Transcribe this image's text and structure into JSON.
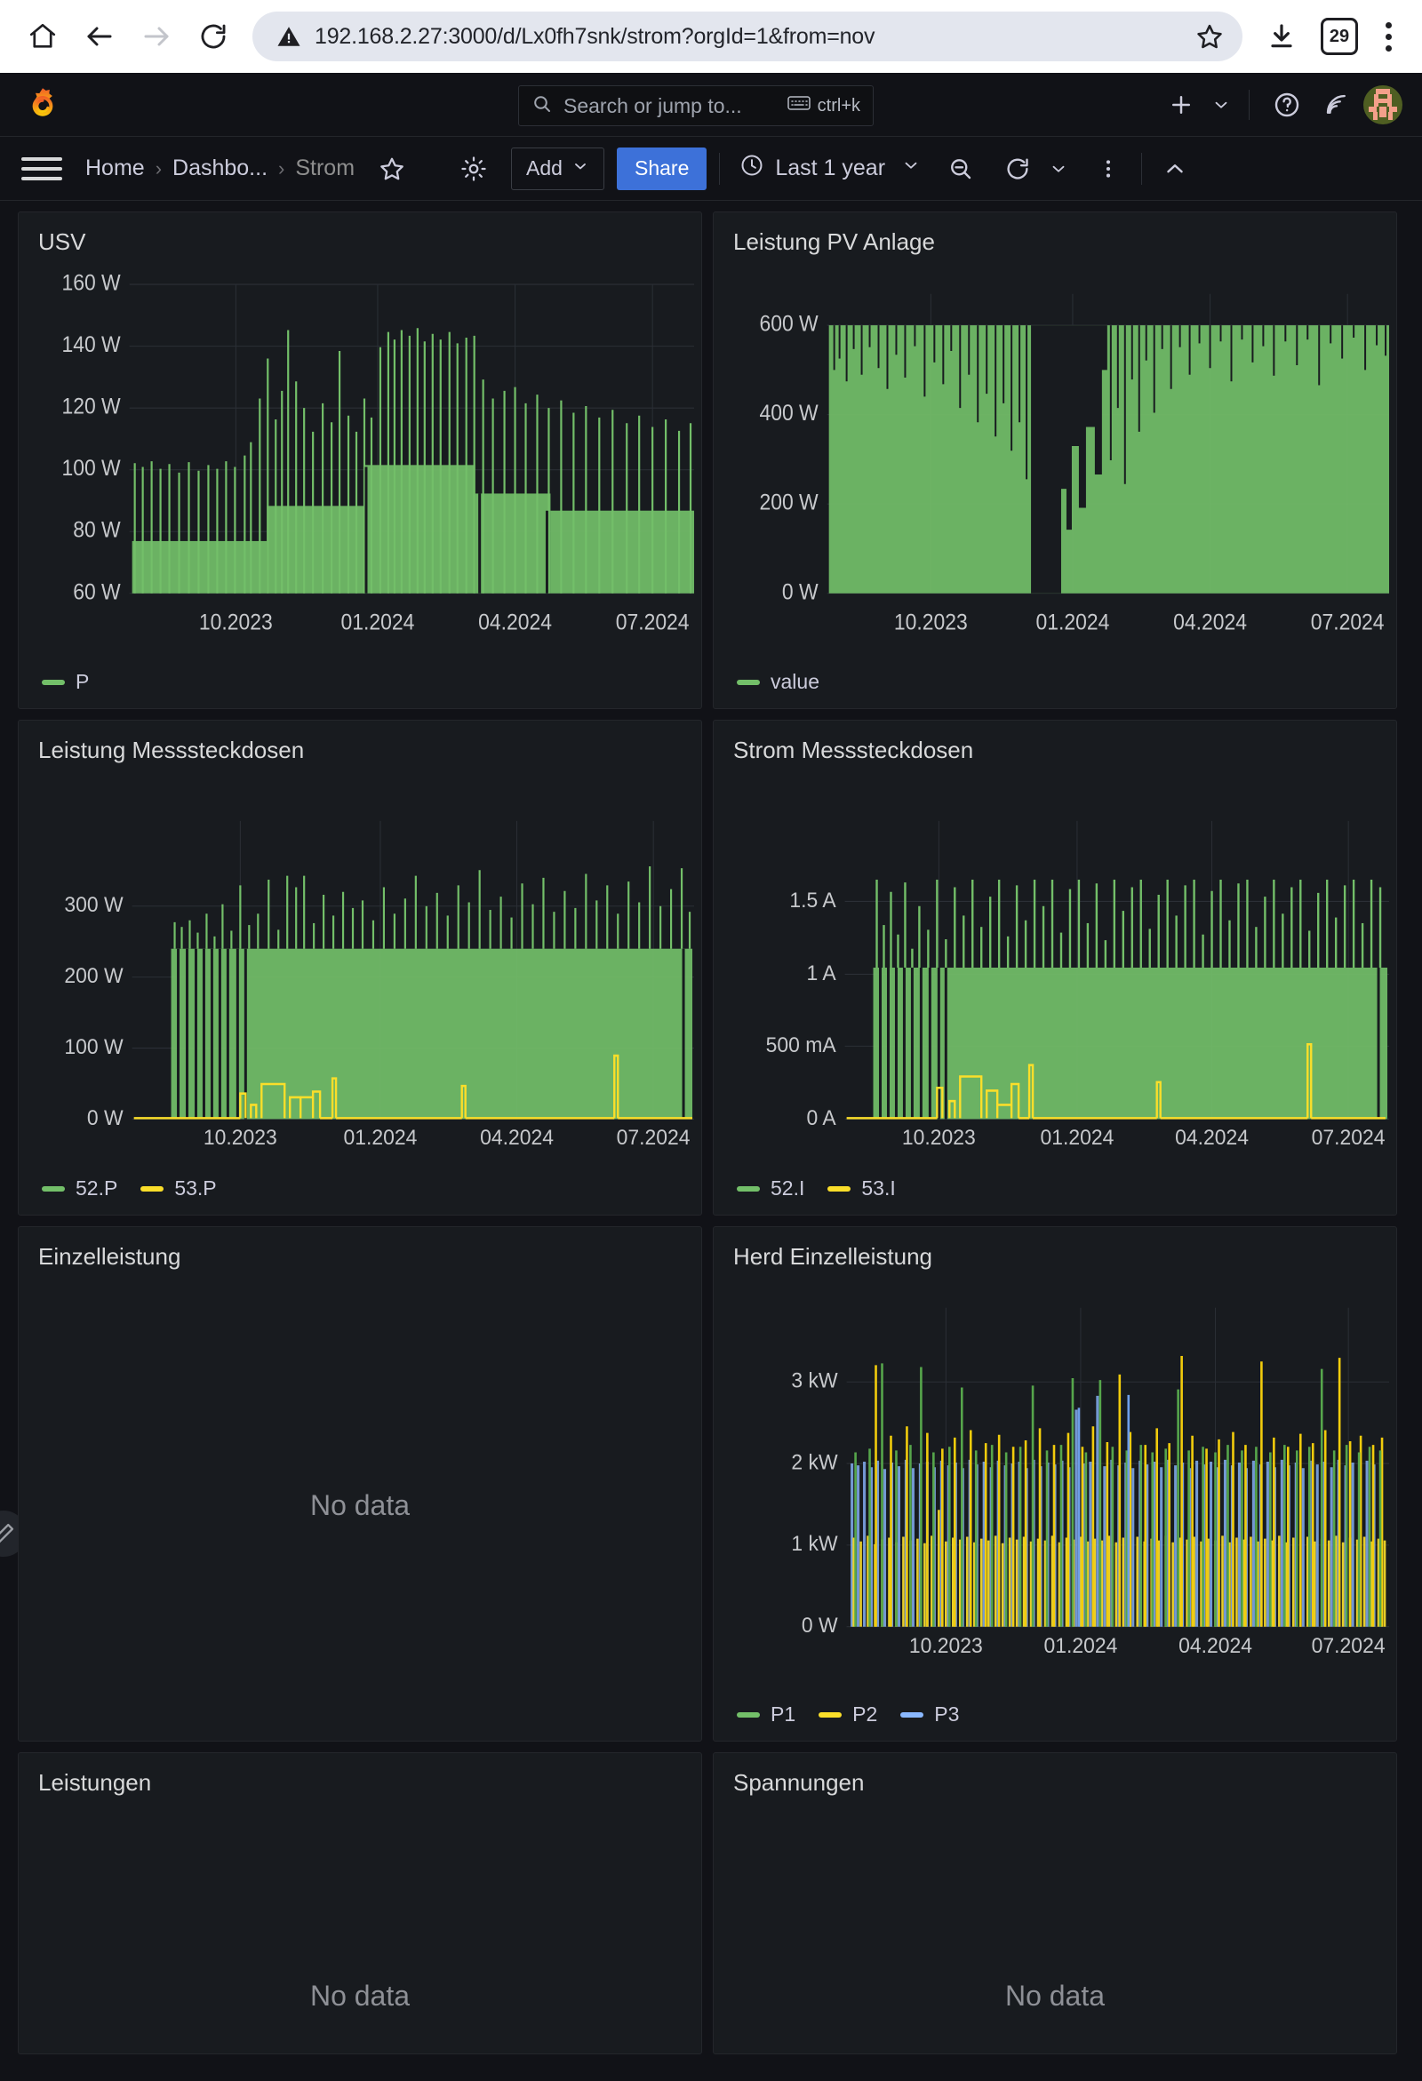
{
  "browser": {
    "url": "192.168.2.27:3000/d/Lx0fh7snk/strom?orgId=1&from=nov",
    "tab_count": "29",
    "icons": {
      "home": "home-icon",
      "back": "back-arrow-icon",
      "forward": "forward-arrow-icon",
      "reload": "reload-icon",
      "not_secure": "not-secure-warning-icon",
      "bookmark": "bookmark-star-icon",
      "download": "download-icon",
      "menu": "browser-menu-icon"
    }
  },
  "grafana_nav": {
    "search_placeholder": "Search or jump to...",
    "shortcut": "ctrl+k",
    "plus_label": "",
    "icons": [
      "grafana-logo-icon",
      "search-icon",
      "keyboard-icon",
      "plus-icon",
      "chevron-down-icon",
      "help-icon",
      "news-icon",
      "avatar"
    ]
  },
  "controls": {
    "breadcrumb": [
      "Home",
      "Dashbo...",
      "Strom"
    ],
    "separator": "›",
    "add_label": "Add",
    "share_label": "Share",
    "time_range": "Last 1 year",
    "icons": [
      "hamburger-icon",
      "star-icon",
      "gear-icon",
      "clock-icon",
      "zoom-out-icon",
      "refresh-icon",
      "chevron-down-icon",
      "more-vertical-icon",
      "collapse-chevron-up-icon"
    ]
  },
  "panels": [
    {
      "title": "USV",
      "has_data": true
    },
    {
      "title": "Leistung PV Anlage",
      "has_data": true
    },
    {
      "title": "Leistung Messsteckdosen",
      "has_data": true
    },
    {
      "title": "Strom Messsteckdosen",
      "has_data": true
    },
    {
      "title": "Einzelleistung",
      "has_data": false,
      "empty_text": "No data"
    },
    {
      "title": "Herd Einzelleistung",
      "has_data": true
    },
    {
      "title": "Leistungen",
      "has_data": false,
      "empty_text": "No data"
    },
    {
      "title": "Spannungen",
      "has_data": false,
      "empty_text": "No data"
    }
  ],
  "colors": {
    "green": "#73bf69",
    "yellow": "#fade2a",
    "blue": "#8ab8ff",
    "panel_bg": "#181b1f",
    "page_bg": "#111217",
    "accent_blue": "#3d71d9"
  },
  "chart_data": [
    {
      "type": "area",
      "title": "USV",
      "ylabel": "",
      "xlabel": "",
      "yticks": [
        "60 W",
        "80 W",
        "100 W",
        "120 W",
        "140 W",
        "160 W"
      ],
      "yvalues": [
        60,
        80,
        100,
        120,
        140,
        160
      ],
      "ylim": [
        52,
        168
      ],
      "xticks": [
        "10.2023",
        "01.2024",
        "04.2024",
        "07.2024"
      ],
      "grid": true,
      "legend": [
        {
          "name": "P",
          "color": "#73bf69"
        }
      ],
      "legend_position": "bottom-left",
      "series": [
        {
          "name": "P",
          "color": "#73bf69",
          "baseline": 60,
          "description": "Noisy band rising from ~62-78 W before 10.2023, stepping to ~70-100 W, then ~95-118 W plateau after 01.2024, with frequent spikes to 120-150 W",
          "band_low": [
            62,
            62,
            63,
            63,
            64,
            65,
            66,
            68,
            70,
            72,
            73,
            70,
            68,
            70,
            72,
            74,
            95,
            96,
            97,
            96,
            95,
            68,
            70,
            72,
            74,
            76,
            78,
            76,
            74,
            72
          ],
          "band_high": [
            78,
            79,
            80,
            82,
            84,
            86,
            90,
            95,
            100,
            100,
            98,
            95,
            96,
            98,
            100,
            102,
            115,
            116,
            118,
            117,
            115,
            100,
            102,
            104,
            106,
            105,
            103,
            101,
            100,
            98
          ],
          "spikes": [
            105,
            140,
            148,
            138,
            142,
            135,
            128,
            145,
            147,
            143,
            146,
            144,
            140,
            122,
            125,
            120,
            118
          ]
        }
      ]
    },
    {
      "type": "area",
      "title": "Leistung PV Anlage",
      "yticks": [
        "0 W",
        "200 W",
        "400 W",
        "600 W"
      ],
      "yvalues": [
        0,
        200,
        400,
        600
      ],
      "ylim": [
        0,
        640
      ],
      "xticks": [
        "10.2023",
        "01.2024",
        "04.2024",
        "07.2024"
      ],
      "grid": true,
      "legend": [
        {
          "name": "value",
          "color": "#73bf69"
        }
      ],
      "legend_position": "bottom-left",
      "series": [
        {
          "name": "value",
          "color": "#73bf69",
          "description": "Dense daily max near 600 W most of the year; dips toward 0-300 W around 12.2023-01.2024 (winter), recovering to 600 W by 03.2024",
          "envelope": [
            600,
            600,
            600,
            600,
            595,
            590,
            585,
            560,
            520,
            470,
            400,
            330,
            260,
            180,
            120,
            60,
            140,
            250,
            340,
            300,
            420,
            520,
            570,
            595,
            600,
            600,
            600,
            600,
            600,
            600
          ]
        }
      ]
    },
    {
      "type": "area",
      "title": "Leistung Messsteckdosen",
      "yticks": [
        "0 W",
        "100 W",
        "200 W",
        "300 W"
      ],
      "yvalues": [
        0,
        100,
        200,
        300
      ],
      "ylim": [
        0,
        360
      ],
      "xticks": [
        "10.2023",
        "01.2024",
        "04.2024",
        "07.2024"
      ],
      "grid": true,
      "legend": [
        {
          "name": "52.P",
          "color": "#73bf69"
        },
        {
          "name": "53.P",
          "color": "#fade2a"
        }
      ],
      "legend_position": "bottom-left",
      "series": [
        {
          "name": "52.P",
          "color": "#73bf69",
          "description": "Solid filled band from ~0 to ~240 W starting just before 10.2023 through end of range, with spikes to 300-340 W",
          "plateau": 240,
          "spike_max": 345
        },
        {
          "name": "53.P",
          "color": "#fade2a",
          "description": "Near 0 W for almost all of the range; small bursts of 20-55 W around 10.2023-11.2023, a spike ~30 W near 02.2024 and ~90 W near 06.2024",
          "plateau": 0,
          "spike_max": 90
        }
      ]
    },
    {
      "type": "area",
      "title": "Strom Messsteckdosen",
      "yticks": [
        "0 A",
        "500 mA",
        "1 A",
        "1.5 A"
      ],
      "yvalues": [
        0,
        0.5,
        1,
        1.5
      ],
      "ylim": [
        0,
        1.72
      ],
      "xticks": [
        "10.2023",
        "01.2024",
        "04.2024",
        "07.2024"
      ],
      "grid": true,
      "legend": [
        {
          "name": "52.I",
          "color": "#73bf69"
        },
        {
          "name": "53.I",
          "color": "#fade2a"
        }
      ],
      "legend_position": "bottom-left",
      "series": [
        {
          "name": "52.I",
          "color": "#73bf69",
          "description": "Solid filled band 0 to ~1.05 A from just before 10.2023 onward, with frequent spikes to 1.3-1.65 A",
          "plateau": 1.05,
          "spike_max": 1.65
        },
        {
          "name": "53.I",
          "color": "#fade2a",
          "description": "Near 0 A throughout; small bursts to 0.08-0.25 A around 10.2023-11.2023, a spike to ~0.15 A near 02.2024 and ~0.45 A near 06.2024",
          "plateau": 0,
          "spike_max": 0.45
        }
      ]
    },
    {
      "type": "bar",
      "title": "Herd Einzelleistung",
      "yticks": [
        "0 W",
        "1 kW",
        "2 kW",
        "3 kW"
      ],
      "yvalues": [
        0,
        1000,
        2000,
        3000
      ],
      "ylim": [
        0,
        3400
      ],
      "xticks": [
        "10.2023",
        "01.2024",
        "04.2024",
        "07.2024"
      ],
      "grid": true,
      "legend": [
        {
          "name": "P1",
          "color": "#73bf69"
        },
        {
          "name": "P2",
          "color": "#fade2a"
        },
        {
          "name": "P3",
          "color": "#8ab8ff"
        }
      ],
      "legend_position": "bottom-left",
      "series": [
        {
          "name": "P1",
          "color": "#73bf69",
          "typical": 2150,
          "spike_max": 3200,
          "description": "Green bars typically reaching ~2.1 kW, occasional spikes to 3.0-3.2 kW"
        },
        {
          "name": "P2",
          "color": "#fade2a",
          "typical": 1150,
          "spike_max": 3300,
          "description": "Yellow bars typically ~1.1 kW, frequent tall spikes to 2.4-3.3 kW"
        },
        {
          "name": "P3",
          "color": "#8ab8ff",
          "typical": 2000,
          "spike_max": 2900,
          "description": "Blue bars typically ~2.0 kW, occasional spikes to ~2.9 kW"
        }
      ]
    }
  ]
}
